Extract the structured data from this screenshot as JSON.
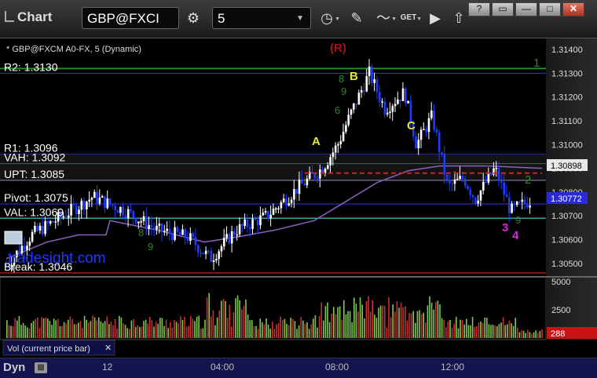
{
  "window": {
    "title": "Chart",
    "symbol": "GBP@FXCI",
    "interval": "5",
    "buttons": {
      "help": "?",
      "restore": "▭",
      "minimize": "—",
      "maximize": "□",
      "close": "✕"
    },
    "get_label": "GET"
  },
  "chart": {
    "caption": "* GBP@FXCM A0-FX, 5 (Dynamic)",
    "watermark": "tradesight.com",
    "pattern_marker": "(R)",
    "price_axis": [
      "1.31400",
      "1.31300",
      "1.31200",
      "1.31100",
      "1.31000",
      "1.30900",
      "1.30800",
      "1.30700",
      "1.30600",
      "1.30500"
    ],
    "price_axis_range": [
      1.3045,
      1.3144
    ],
    "current_price_label": "1.30772",
    "current_price": 1.30772,
    "marker_price_label": "1.30898",
    "marker_price": 1.30898,
    "levels": [
      {
        "label": "R2: 1.3130",
        "value": 1.313,
        "color": "#2828c8"
      },
      {
        "label": "R1: 1.3096",
        "value": 1.3096,
        "color": "#2828c8"
      },
      {
        "label": "VAH: 1.3092",
        "value": 1.3092,
        "color": "#40c0c0"
      },
      {
        "label": "UPT: 1.3085",
        "value": 1.3085,
        "color": "#b8a0e0"
      },
      {
        "label": "Pivot: 1.3075",
        "value": 1.3075,
        "color": "#2828c8"
      },
      {
        "label": "VAL: 1.3069",
        "value": 1.3069,
        "color": "#40c0c0"
      },
      {
        "label": "Break: 1.3046",
        "value": 1.3046,
        "color": "#cc2020"
      }
    ],
    "green_line_value": 1.3132,
    "red_dashed_value": 1.3088,
    "wave_labels": [
      {
        "text": "A",
        "color": "#e8e832"
      },
      {
        "text": "B",
        "color": "#e8e832"
      },
      {
        "text": "C",
        "color": "#e8e832"
      },
      {
        "text": "1",
        "color": "#2a8a2a"
      },
      {
        "text": "2",
        "color": "#2a8a2a"
      },
      {
        "text": "3",
        "color": "#e020e0"
      },
      {
        "text": "4",
        "color": "#e020e0"
      }
    ],
    "count_digits": [
      "8",
      "9",
      "6",
      "8",
      "9",
      "9",
      "9"
    ]
  },
  "volume": {
    "axis": [
      "5000",
      "2500"
    ],
    "axis_max": 5000,
    "current_label": "288",
    "current_value": 288,
    "legend": "Vol (current price bar)",
    "legend_close": "✕"
  },
  "time_axis": {
    "mode_label": "Dyn",
    "lock_icon": "lock-icon",
    "ticks": [
      "12",
      "04:00",
      "08:00",
      "12:00"
    ]
  },
  "colors": {
    "up_bar": "#ffffff",
    "down_bar": "#1e3cff",
    "ma": "#8a60c0",
    "vol_up": "#7ec850",
    "vol_down": "#c83030",
    "bg": "#000000"
  }
}
